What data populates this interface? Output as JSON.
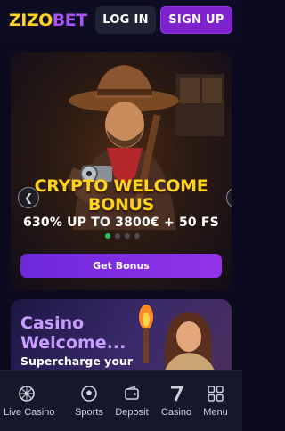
{
  "header": {
    "logo_part1": "ZIZO",
    "logo_part2": "BET",
    "login_label": "LOG IN",
    "signup_label": "SIGN UP"
  },
  "banner": {
    "headline_line1": "CRYPTO WELCOME",
    "headline_line2": "BONUS",
    "subline": "630% UP TO 3800€ + 50 FS",
    "slide_count": 4,
    "active_slide": 1,
    "cta_label": "Get Bonus"
  },
  "casino_card": {
    "title_line1": "Casino",
    "title_line2": "Welcome...",
    "subtitle": "Supercharge your"
  },
  "bottom_nav": {
    "items": [
      {
        "label": "Live Casino",
        "icon": "roulette-icon"
      },
      {
        "label": "Sports",
        "icon": "soccer-ball-icon"
      },
      {
        "label": "Deposit",
        "icon": "wallet-icon"
      },
      {
        "label": "Casino",
        "icon": "seven-icon"
      },
      {
        "label": "Menu",
        "icon": "grid-icon"
      }
    ]
  },
  "colors": {
    "accent_yellow": "#ffd21f",
    "accent_purple": "#7e22ce",
    "active_dot": "#22c55e"
  }
}
